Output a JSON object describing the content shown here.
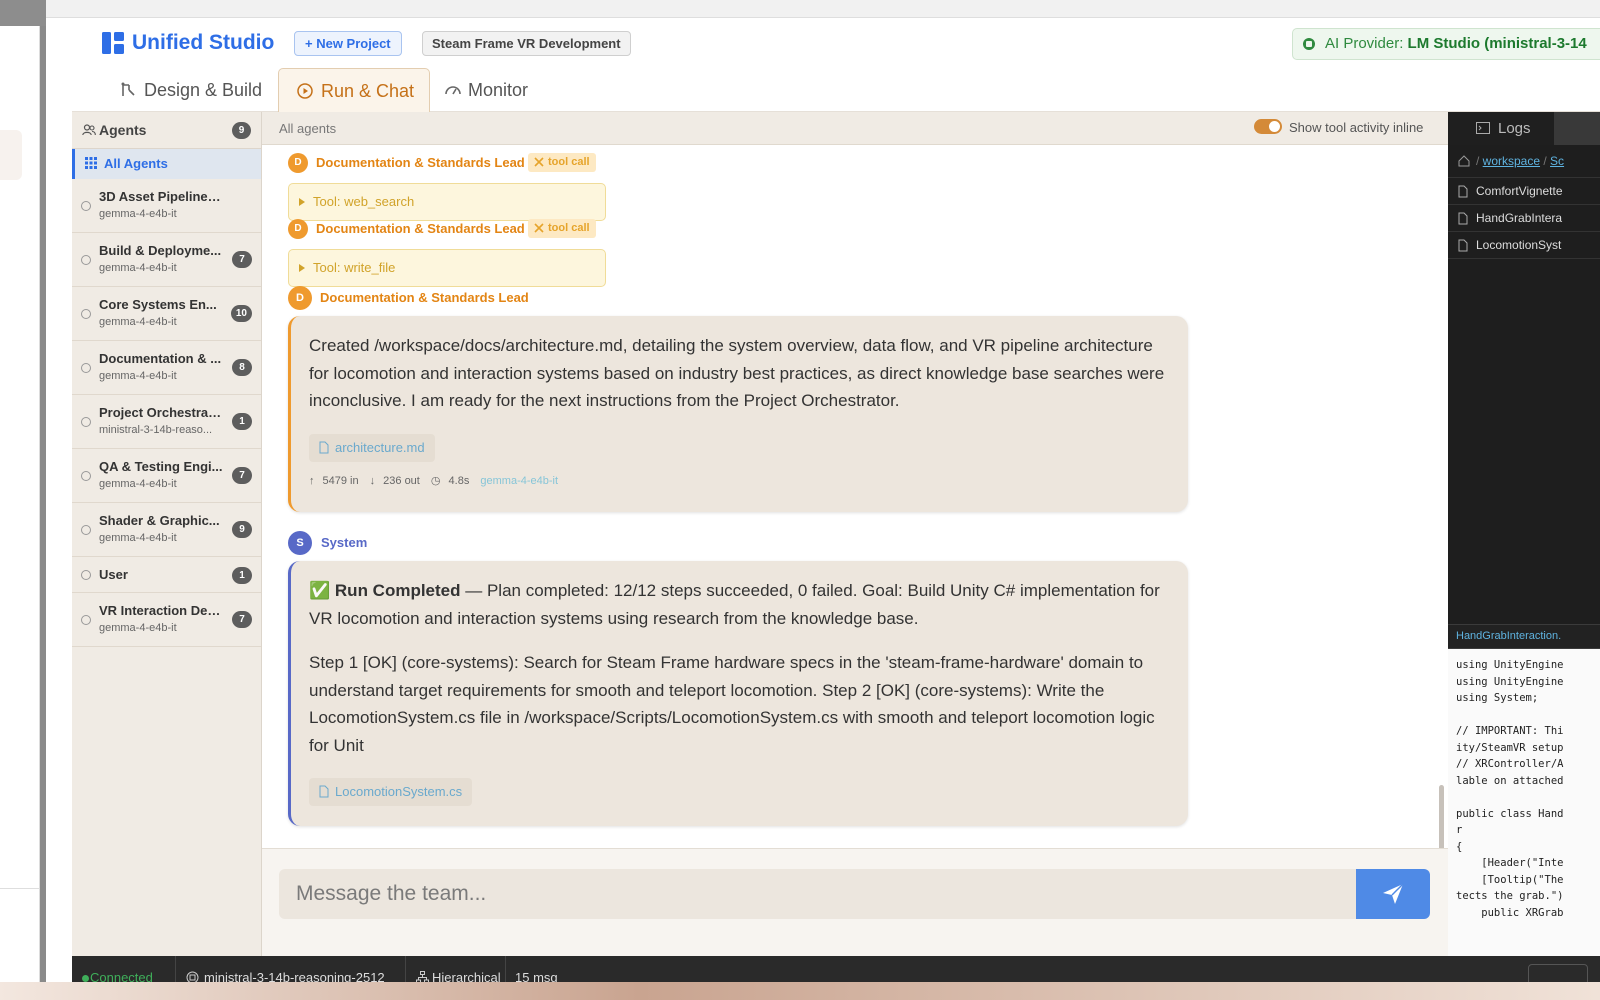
{
  "app": {
    "title": "Unified Studio",
    "new_project_label": "New Project",
    "project_name": "Steam Frame VR Development",
    "provider_label": "AI Provider:",
    "provider_value": "LM Studio (ministral-3-14"
  },
  "tabs": [
    {
      "label": "Design & Build",
      "icon": "design-build-icon"
    },
    {
      "label": "Run & Chat",
      "icon": "play-circle-icon",
      "active": true
    },
    {
      "label": "Monitor",
      "icon": "gauge-icon"
    }
  ],
  "sidebar": {
    "title": "Agents",
    "count": "9",
    "all_label": "All Agents",
    "agents": [
      {
        "name": "3D Asset Pipeline Engi...",
        "model": "gemma-4-e4b-it",
        "count": ""
      },
      {
        "name": "Build & Deployme...",
        "model": "gemma-4-e4b-it",
        "count": "7"
      },
      {
        "name": "Core Systems En...",
        "model": "gemma-4-e4b-it",
        "count": "10"
      },
      {
        "name": "Documentation & ...",
        "model": "gemma-4-e4b-it",
        "count": "8"
      },
      {
        "name": "Project Orchestrator",
        "model": "ministral-3-14b-reaso...",
        "count": "1"
      },
      {
        "name": "QA & Testing Engi...",
        "model": "gemma-4-e4b-it",
        "count": "7"
      },
      {
        "name": "Shader & Graphic...",
        "model": "gemma-4-e4b-it",
        "count": "9"
      },
      {
        "name": "User",
        "model": "",
        "count": "1"
      },
      {
        "name": "VR Interaction Dev...",
        "model": "gemma-4-e4b-it",
        "count": "7"
      }
    ]
  },
  "chat": {
    "filter_label": "All agents",
    "toggle_label": "Show tool activity inline",
    "tool_events": [
      {
        "sender": "Documentation & Standards Lead",
        "avatar": "D",
        "badge": "tool call",
        "tool": "Tool: web_search"
      },
      {
        "sender": "Documentation & Standards Lead",
        "avatar": "D",
        "badge": "tool call",
        "tool": "Tool: write_file"
      }
    ],
    "message1": {
      "sender": "Documentation & Standards Lead",
      "avatar": "D",
      "text": "Created /workspace/docs/architecture.md, detailing the system overview, data flow, and VR pipeline architecture for locomotion and interaction systems based on industry best practices, as direct knowledge base searches were inconclusive. I am ready for the next instructions from the Project Orchestrator.",
      "file": "architecture.md",
      "tokens_in": "5479 in",
      "tokens_out": "236 out",
      "duration": "4.8s",
      "model": "gemma-4-e4b-it"
    },
    "message2": {
      "sender": "System",
      "avatar": "S",
      "check": "✅",
      "title": "Run Completed",
      "summary": " — Plan completed: 12/12 steps succeeded, 0 failed. Goal: Build Unity C# implementation for VR locomotion and interaction systems using research from the knowledge base.",
      "steps": "Step 1 [OK] (core-systems): Search for Steam Frame hardware specs in the 'steam-frame-hardware' domain to understand target requirements for smooth and teleport locomotion. Step 2 [OK] (core-systems): Write the LocomotionSystem.cs file in /workspace/Scripts/LocomotionSystem.cs with smooth and teleport locomotion logic for Unit",
      "file": "LocomotionSystem.cs"
    },
    "composer_placeholder": "Message the team..."
  },
  "right_panel": {
    "tab_label": "Logs",
    "crumb_root": "workspace",
    "crumb_next": "Sc",
    "files": [
      "ComfortVignette",
      "HandGrabIntera",
      "LocomotionSyst"
    ],
    "viewer_title": "HandGrabInteraction.",
    "code": "using UnityEngine\nusing UnityEngine\nusing System;\n\n// IMPORTANT: Thi\nity/SteamVR setup\n// XRController/A\nlable on attached\n\npublic class Hand\nr\n{\n    [Header(\"Inte\n    [Tooltip(\"The\ntects the grab.\")\n    public XRGrab"
  },
  "status": {
    "connection": "Connected",
    "model": "ministral-3-14b-reasoning-2512",
    "mode": "Hierarchical",
    "messages": "15 msg"
  },
  "colors": {
    "accent_blue": "#2e6ee6",
    "accent_orange": "#e38514",
    "system_purple": "#5869c7",
    "connected_green": "#3fae5a"
  }
}
